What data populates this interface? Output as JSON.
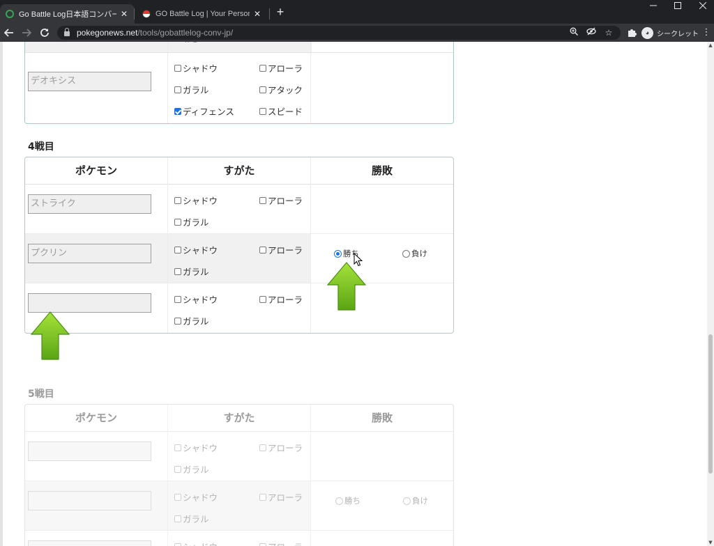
{
  "browser": {
    "tabs": [
      {
        "title": "Go Battle Log日本語コンバーター |",
        "active": true,
        "icon": "gobattlelog-favicon"
      },
      {
        "title": "GO Battle Log | Your Personal Ba",
        "active": false,
        "icon": "pokeball-favicon"
      }
    ],
    "url_host": "pokegonews.net",
    "url_path": "/tools/gobattlelog-conv-jp/",
    "profile_label": "シークレット",
    "controls": {
      "minimize": "—",
      "maximize": "☐",
      "close": "✕",
      "new_tab": "+",
      "back": "←",
      "forward": "→",
      "reload": "↻"
    }
  },
  "labels": {
    "shadow": "シャドウ",
    "alola": "アローラ",
    "galar": "ガラル",
    "attack": "アタック",
    "defense": "ディフェンス",
    "speed": "スピード",
    "win": "勝ち",
    "lose": "負け"
  },
  "headers": {
    "pokemon": "ポケモン",
    "form": "すがた",
    "result": "勝敗"
  },
  "prev_table": {
    "header_fragment": "ねむ",
    "rows": [
      {
        "name_placeholder": "デオキシス",
        "defense_checked": true
      }
    ]
  },
  "battle4": {
    "title": "4戦目",
    "rows": [
      {
        "name_placeholder": "ストライク"
      },
      {
        "name_placeholder": "プクリン",
        "result": "win"
      },
      {
        "name_placeholder": ""
      }
    ]
  },
  "battle5": {
    "title": "5戦目",
    "rows": [
      {
        "name_placeholder": ""
      },
      {
        "name_placeholder": ""
      },
      {
        "name_placeholder": ""
      }
    ]
  },
  "colors": {
    "accent": "#1a73e8",
    "arrow_green": "#7cc61e",
    "chrome_dark": "#202124"
  }
}
